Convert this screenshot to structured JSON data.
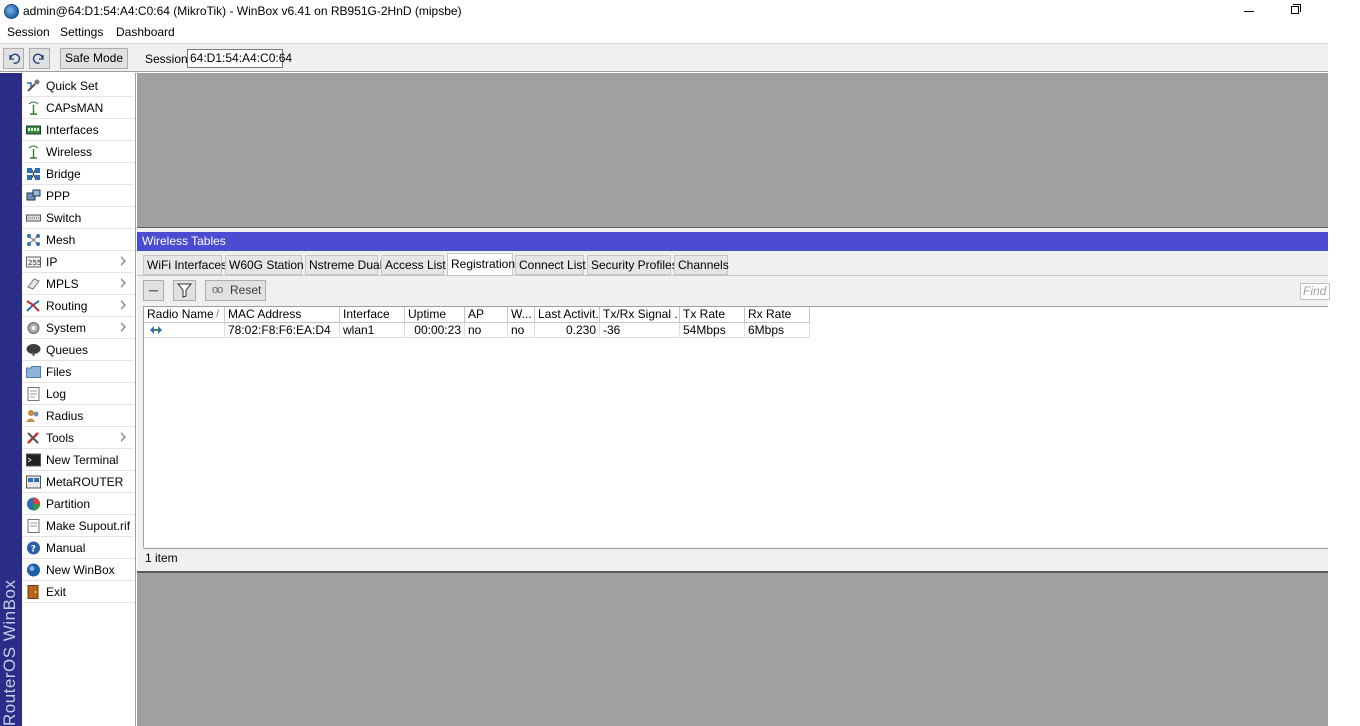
{
  "window": {
    "title": "admin@64:D1:54:A4:C0:64 (MikroTik) - WinBox v6.41 on RB951G-2HnD (mipsbe)"
  },
  "menu": [
    "Session",
    "Settings",
    "Dashboard"
  ],
  "toolbar": {
    "safe_mode_label": "Safe Mode",
    "session_label": "Session:",
    "session_value": "64:D1:54:A4:C0:64"
  },
  "brand_text": "RouterOS WinBox",
  "sidebar": {
    "items": [
      {
        "label": "Quick Set",
        "icon": "quick-set-icon",
        "submenu": false
      },
      {
        "label": "CAPsMAN",
        "icon": "capsman-icon",
        "submenu": false
      },
      {
        "label": "Interfaces",
        "icon": "interfaces-icon",
        "submenu": false
      },
      {
        "label": "Wireless",
        "icon": "wireless-icon",
        "submenu": false
      },
      {
        "label": "Bridge",
        "icon": "bridge-icon",
        "submenu": false
      },
      {
        "label": "PPP",
        "icon": "ppp-icon",
        "submenu": false
      },
      {
        "label": "Switch",
        "icon": "switch-icon",
        "submenu": false
      },
      {
        "label": "Mesh",
        "icon": "mesh-icon",
        "submenu": false
      },
      {
        "label": "IP",
        "icon": "ip-icon",
        "submenu": true
      },
      {
        "label": "MPLS",
        "icon": "mpls-icon",
        "submenu": true
      },
      {
        "label": "Routing",
        "icon": "routing-icon",
        "submenu": true
      },
      {
        "label": "System",
        "icon": "system-icon",
        "submenu": true
      },
      {
        "label": "Queues",
        "icon": "queues-icon",
        "submenu": false
      },
      {
        "label": "Files",
        "icon": "files-icon",
        "submenu": false
      },
      {
        "label": "Log",
        "icon": "log-icon",
        "submenu": false
      },
      {
        "label": "Radius",
        "icon": "radius-icon",
        "submenu": false
      },
      {
        "label": "Tools",
        "icon": "tools-icon",
        "submenu": true
      },
      {
        "label": "New Terminal",
        "icon": "terminal-icon",
        "submenu": false
      },
      {
        "label": "MetaROUTER",
        "icon": "metarouter-icon",
        "submenu": false
      },
      {
        "label": "Partition",
        "icon": "partition-icon",
        "submenu": false
      },
      {
        "label": "Make Supout.rif",
        "icon": "supout-icon",
        "submenu": false
      },
      {
        "label": "Manual",
        "icon": "manual-icon",
        "submenu": false
      },
      {
        "label": "New WinBox",
        "icon": "winbox-icon",
        "submenu": false
      },
      {
        "label": "Exit",
        "icon": "exit-icon",
        "submenu": false
      }
    ]
  },
  "wireless_tables": {
    "title": "Wireless Tables",
    "tabs": [
      "WiFi Interfaces",
      "W60G Station",
      "Nstreme Dual",
      "Access List",
      "Registration",
      "Connect List",
      "Security Profiles",
      "Channels"
    ],
    "active_tab": "Registration",
    "reset_label": "Reset",
    "find_placeholder": "Find",
    "columns": [
      "Radio Name",
      "MAC Address",
      "Interface",
      "Uptime",
      "AP",
      "W...",
      "Last Activit...",
      "Tx/Rx Signal ...",
      "Tx Rate",
      "Rx Rate"
    ],
    "rows": [
      {
        "radio_name": "",
        "mac": "78:02:F8:F6:EA:D4",
        "interface": "wlan1",
        "uptime": "00:00:23",
        "ap": "no",
        "w": "no",
        "last_activity": "0.230",
        "signal": "-36",
        "tx_rate": "54Mbps",
        "rx_rate": "6Mbps"
      }
    ],
    "status": "1 item"
  },
  "colors": {
    "title_bar": "#4b4cd2",
    "brand_strip": "#2a2d86",
    "workspace": "#a0a0a0"
  }
}
